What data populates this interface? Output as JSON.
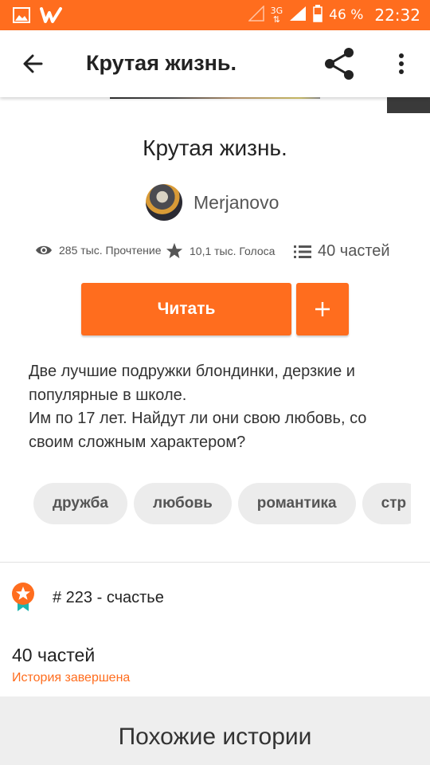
{
  "status_bar": {
    "network": "3G",
    "battery": "46 %",
    "time": "22:32",
    "color": "#ff6d1e"
  },
  "appbar": {
    "title": "Крутая жизнь.",
    "back_icon": "arrow-left-icon",
    "share_icon": "share-icon",
    "more_icon": "more-vert-icon"
  },
  "story": {
    "title": "Крутая жизнь.",
    "author": "Merjanovo",
    "stats": {
      "reads": "285 тыс. Прочтение",
      "votes": "10,1 тыс. Голоса",
      "parts": "40 частей"
    },
    "read_button": "Читать",
    "add_button": "+",
    "description": [
      "Две лучшие подружки блондинки, дерзкие и популярные в школе.",
      "Им по 17 лет. Найдут ли они свою любовь, со своим сложным характером?"
    ],
    "tags": [
      "дружба",
      "любовь",
      "романтика",
      "стр"
    ],
    "rank": "# 223 - счастье",
    "parts_count": "40 частей",
    "parts_status": "История завершена"
  },
  "similar": {
    "title": "Похожие истории"
  },
  "colors": {
    "accent": "#ff6d1e",
    "tag_bg": "#ececec"
  }
}
